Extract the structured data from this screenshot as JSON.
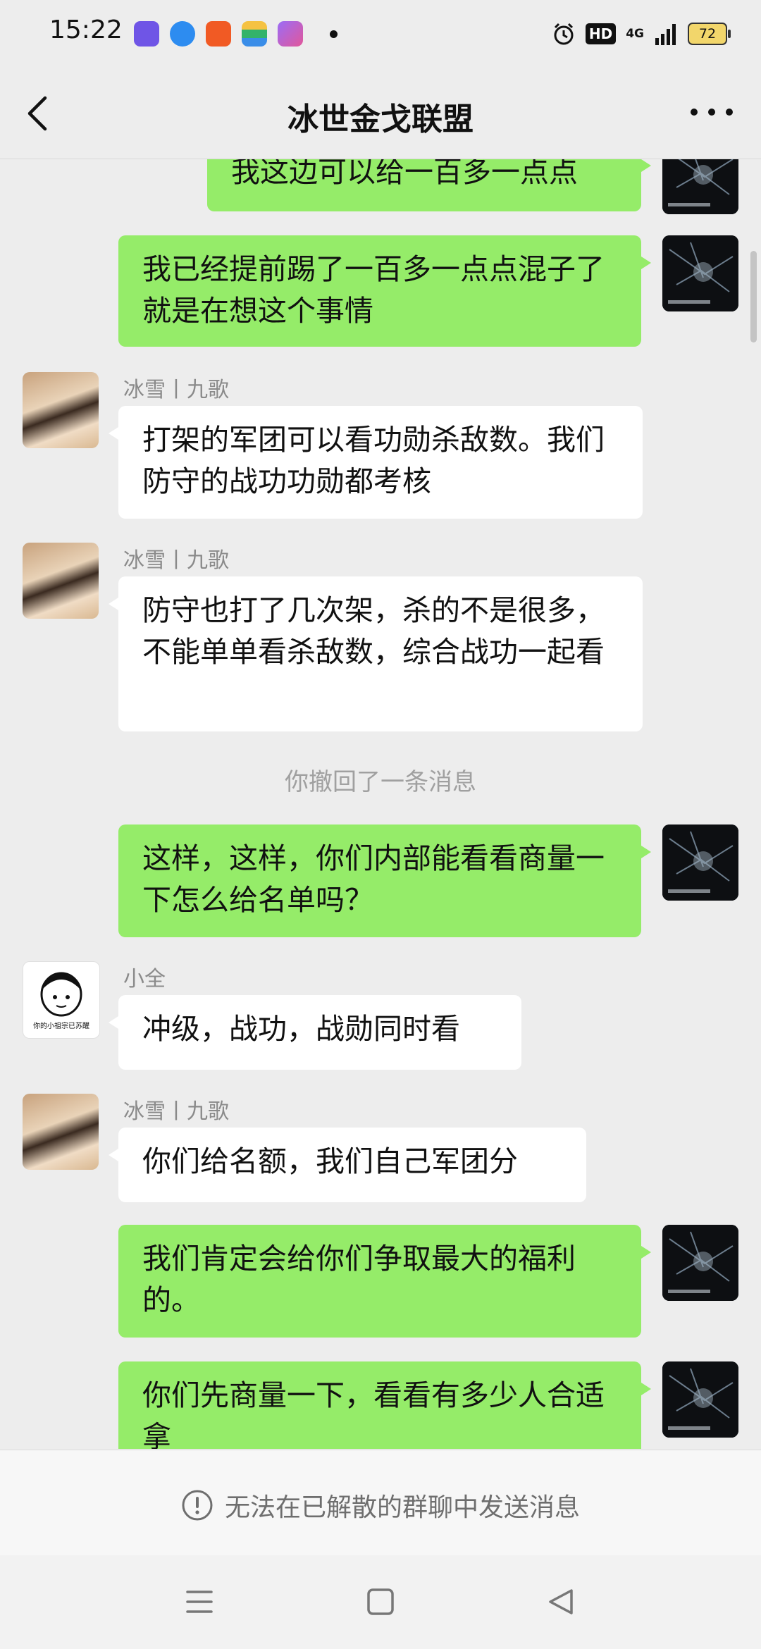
{
  "status_bar": {
    "time": "15:22",
    "hd": "HD",
    "network": "4G",
    "battery": "72"
  },
  "nav": {
    "title": "冰世金戈联盟"
  },
  "messages": [
    {
      "text": "我这边可以给一百多一点点"
    },
    {
      "text": "我已经提前踢了一百多一点点混子了就是在想这个事情"
    },
    {
      "sender": "冰雪丨九歌",
      "text": "打架的军团可以看功勋杀敌数。我们防守的战功功勋都考核"
    },
    {
      "sender": "冰雪丨九歌",
      "text": "防守也打了几次架，杀的不是很多，不能单单看杀敌数，综合战功一起看"
    },
    {
      "text": "这样，这样，你们内部能看看商量一下怎么给名单吗？"
    },
    {
      "sender": "小全",
      "text": "冲级，战功，战勋同时看"
    },
    {
      "sender": "冰雪丨九歌",
      "text": "你们给名额，我们自己军团分"
    },
    {
      "text": "我们肯定会给你们争取最大的福利的。"
    },
    {
      "text": "你们先商量一下，看看有多少人合适拿"
    }
  ],
  "system_message": "你撤回了一条消息",
  "avatar_doodle_caption": "你的小祖宗已苏醒",
  "bottom_notice": "无法在已解散的群聊中发送消息"
}
